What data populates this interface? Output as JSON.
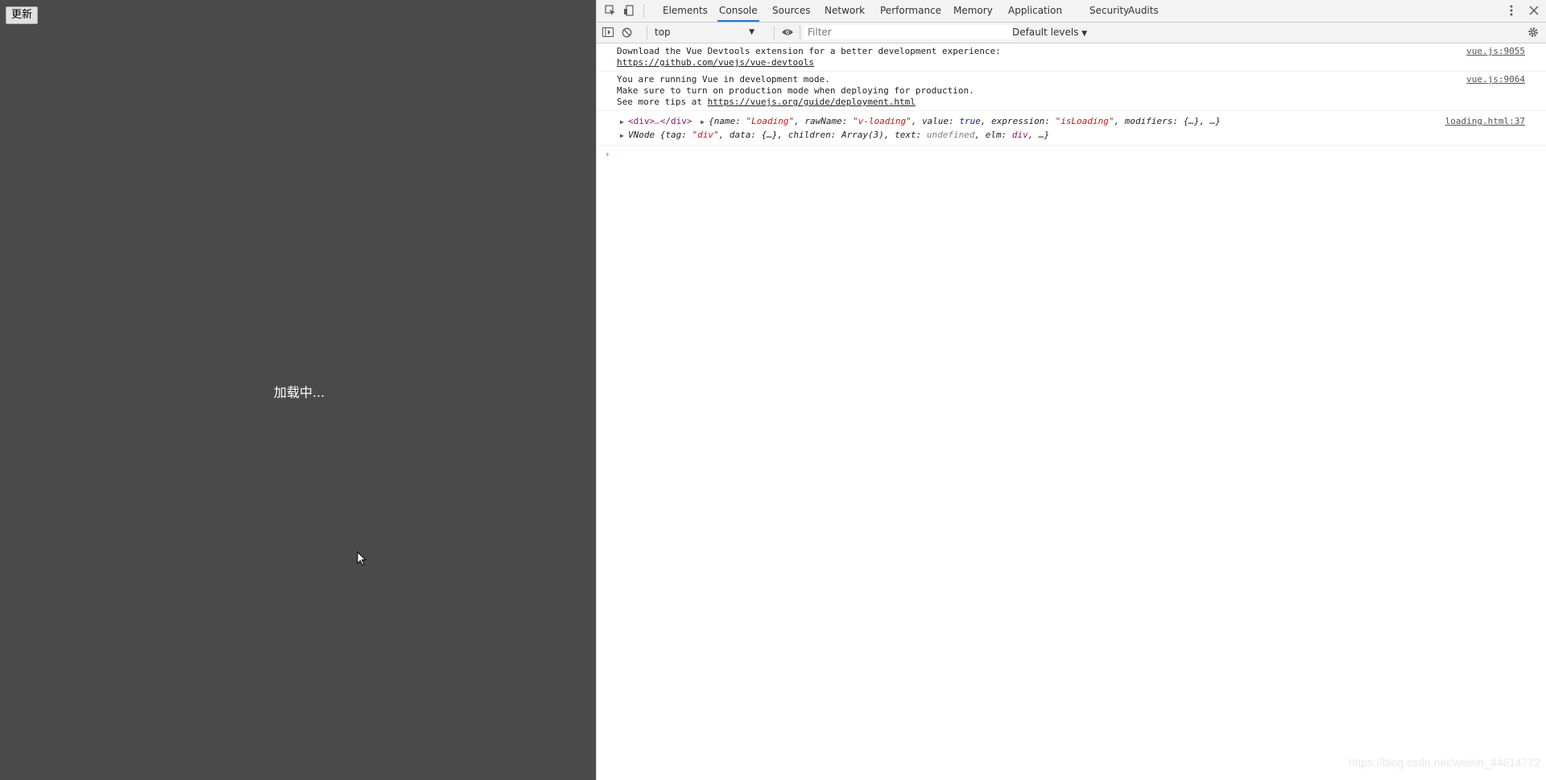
{
  "page": {
    "update_button": "更新",
    "loading_text": "加载中..."
  },
  "devtools": {
    "tabs": [
      "Elements",
      "Console",
      "Sources",
      "Network",
      "Performance",
      "Memory",
      "Application",
      "Security",
      "Audits"
    ],
    "active_tab": "Console",
    "toolbar": {
      "context": "top",
      "filter_placeholder": "Filter",
      "levels": "Default levels"
    },
    "messages": [
      {
        "line1": "Download the Vue Devtools extension for a better development experience:",
        "link": "https://github.com/vuejs/vue-devtools",
        "source": "vue.js:9055"
      },
      {
        "line1": "You are running Vue in development mode.",
        "line2": "Make sure to turn on production mode when deploying for production.",
        "line3_prefix": "See more tips at ",
        "link": "https://vuejs.org/guide/deployment.html",
        "source": "vue.js:9064"
      },
      {
        "source": "loading.html:37",
        "elem_open": "<div>",
        "elem_ellipsis": "…",
        "elem_close": "</div>",
        "obj1_parts": [
          "{name: ",
          "\"Loading\"",
          ", rawName: ",
          "\"v-loading\"",
          ", value: ",
          "true",
          ", expression: ",
          "\"isLoading\"",
          ", modifiers: {…}, …}"
        ],
        "vnode_label": "VNode",
        "obj2_parts": [
          "{tag: ",
          "\"div\"",
          ", data: {…}, children: Array(3), text: ",
          "undefined",
          ", elm: ",
          "div",
          ", …}"
        ]
      }
    ],
    "prompt": "›"
  },
  "watermark": "https://blog.csdn.net/weixin_44614772",
  "colors": {
    "page_bg": "#4a4a4a",
    "accent": "#1a73e8",
    "string": "#c41a16",
    "keyword": "#0d22aa"
  }
}
